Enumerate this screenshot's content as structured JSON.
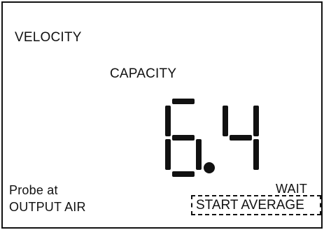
{
  "display": {
    "mode_labels": {
      "velocity": "VELOCITY",
      "capacity": "CAPACITY"
    },
    "reading": {
      "value": "6.4",
      "digits": [
        "6",
        "4"
      ],
      "decimal_point": true
    },
    "instruction": {
      "line1": "Probe at",
      "line2": "OUTPUT AIR"
    },
    "status": "WAIT",
    "action": {
      "label": "START AVERAGE",
      "focused": true
    }
  },
  "colors": {
    "segment": "#111111",
    "background": "#ffffff",
    "frame": "#111111"
  }
}
